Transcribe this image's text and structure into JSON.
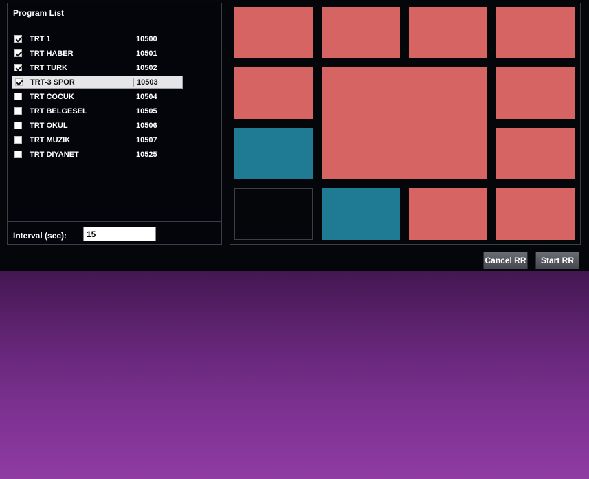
{
  "panel": {
    "title": "Program List"
  },
  "programs": [
    {
      "name": "TRT 1",
      "id": "10500",
      "checked": true,
      "selected": false
    },
    {
      "name": "TRT HABER",
      "id": "10501",
      "checked": true,
      "selected": false
    },
    {
      "name": "TRT TURK",
      "id": "10502",
      "checked": true,
      "selected": false
    },
    {
      "name": "TRT-3 SPOR",
      "id": "10503",
      "checked": true,
      "selected": true
    },
    {
      "name": "TRT COCUK",
      "id": "10504",
      "checked": false,
      "selected": false
    },
    {
      "name": "TRT BELGESEL",
      "id": "10505",
      "checked": false,
      "selected": false
    },
    {
      "name": "TRT OKUL",
      "id": "10506",
      "checked": false,
      "selected": false
    },
    {
      "name": "TRT MUZIK",
      "id": "10507",
      "checked": false,
      "selected": false
    },
    {
      "name": "TRT DIYANET",
      "id": "10525",
      "checked": false,
      "selected": false
    }
  ],
  "interval": {
    "label": "Interval (sec):",
    "value": "15"
  },
  "buttons": {
    "cancel": "Cancel RR",
    "start": "Start RR"
  },
  "colors": {
    "tile_red": "#d66463",
    "tile_teal": "#1f7a94",
    "tile_empty": "#05060a"
  },
  "tiles": [
    {
      "state": "red"
    },
    {
      "state": "red"
    },
    {
      "state": "red"
    },
    {
      "state": "red"
    },
    {
      "state": "red"
    },
    {
      "state": "red-large"
    },
    {
      "state": "red"
    },
    {
      "state": "teal"
    },
    {
      "state": "red"
    },
    {
      "state": "empty"
    },
    {
      "state": "teal"
    },
    {
      "state": "red"
    },
    {
      "state": "red"
    }
  ]
}
